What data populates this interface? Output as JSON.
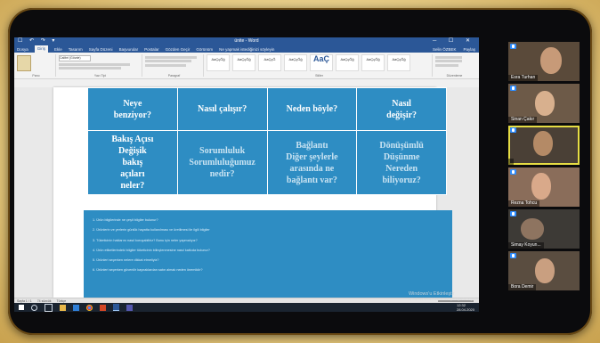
{
  "word": {
    "title": "ünite - Word",
    "quick_access": "☐ ↶ ↷ ▾",
    "window_controls": "─ ☐ ✕",
    "tabs": [
      "Dosya",
      "Giriş",
      "Ekle",
      "Tasarım",
      "Sayfa Düzeni",
      "Başvurular",
      "Postalar",
      "Gözden Geçir",
      "Görünüm",
      "Ne yapmak istediğinizi söyleyin"
    ],
    "active_tab_index": 1,
    "user": "Selin ÖZBEK",
    "share": "Paylaş",
    "ribbon_groups": [
      "Pano",
      "Yazı Tipi",
      "Paragraf",
      "Stiller",
      "Düzenleme"
    ],
    "font_name": "Calibri (Gövde)",
    "font_size": "11",
    "styles": [
      {
        "sample": "AaÇçĞğ",
        "name": "¶ Normal"
      },
      {
        "sample": "AaÇçĞğ",
        "name": "¶ Aralık Yok"
      },
      {
        "sample": "AaÇçĞ",
        "name": "Başlık 1"
      },
      {
        "sample": "AaÇçĞğ",
        "name": "Başlık 2"
      },
      {
        "sample": "AaÇ",
        "name": "Konu Başlığı"
      },
      {
        "sample": "AaÇçĞğ",
        "name": "Alt Konu"
      },
      {
        "sample": "AaÇçĞğ",
        "name": "Hafif Vurg"
      },
      {
        "sample": "AaÇçĞğ",
        "name": "Vurgu"
      }
    ],
    "status_left": "Sayfa 1 / 1",
    "status_words": "74 sözcük",
    "status_lang": "Türkçe"
  },
  "document": {
    "table_row1": [
      "Neye\nbenziyor?",
      "Nasıl çalışır?",
      "Neden böyle?",
      "Nasıl\ndeğişir?"
    ],
    "table_row2": [
      "Bakış Açısı\nDeğişik\nbakış\naçıları\nneler?",
      "Sorumluluk\nSorumluluğumuz\nnedir?",
      "Bağlantı\nDiğer şeylerle\narasında ne\nbağlantı var?",
      "Dönüşümlü\nDüşünme\nNereden\nbiliyoruz?"
    ],
    "list_items": [
      "1. Ürün bilgilerinde ne çeşit bilgiler bulunur?",
      "2. Ürünlerin ve yerlerin günlük hayatta kullanılması ve üretilmesi ile ilgili bilgiler",
      "3. Tüketicinin haklarını nasıl koruyabiliriz? Bunu için neler yapmalıyız?",
      "4. Ürün etiketlerindeki bilgiler tüketicinin bilinçlenmesine nasıl katkıda bulunur?",
      "5. Ürünleri seçerken nelere dikkat etmeliyiz?",
      "6. Ürünleri seçerken güvenilir kaynaklardan satın almak neden önemlidir?"
    ]
  },
  "taskbar": {
    "time": "12:32",
    "date": "28.04.2020"
  },
  "watermark": {
    "line1": "Windows'u Etkinleştir",
    "line2": "Windows'u etkinleştirmek için Ayarlar'a gidin."
  },
  "participants": [
    {
      "name": "Esra Turhan"
    },
    {
      "name": "Sinan Çakır"
    },
    {
      "name": ""
    },
    {
      "name": "Rezna Tohcu"
    },
    {
      "name": "Simay Koyun..."
    },
    {
      "name": "Bora Demir"
    }
  ],
  "colors": {
    "frame": "#0b0b0d",
    "background": "#e8cf8a",
    "word_blue": "#2b5797",
    "table_blue": "#2e8dc3",
    "active_speaker": "#e6dd44",
    "zoom_badge": "#2d8cff"
  },
  "icons": [
    "paste-icon",
    "windows-start-icon",
    "search-icon",
    "task-view-icon",
    "file-explorer-icon",
    "store-icon",
    "chrome-icon",
    "powerpoint-icon",
    "word-icon",
    "teams-icon",
    "zoom-badge-icon"
  ]
}
